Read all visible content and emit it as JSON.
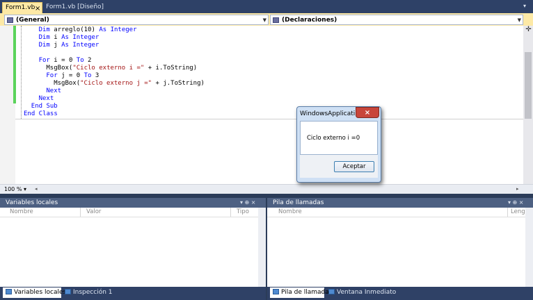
{
  "tabs": [
    {
      "label": "Form1.vb",
      "active": true
    },
    {
      "label": "Form1.vb [Diseño]",
      "active": false
    }
  ],
  "tab_close_glyph": "×",
  "combos": {
    "left": "(General)",
    "right": "(Declaraciones)"
  },
  "code_lines": [
    {
      "indent": "        ",
      "parts": [
        {
          "t": "Dim",
          "k": "kw"
        },
        {
          "t": " arreglo(10) "
        },
        {
          "t": "As",
          "k": "kw"
        },
        {
          "t": " "
        },
        {
          "t": "Integer",
          "k": "kw"
        }
      ]
    },
    {
      "indent": "        ",
      "parts": [
        {
          "t": "Dim",
          "k": "kw"
        },
        {
          "t": " i "
        },
        {
          "t": "As",
          "k": "kw"
        },
        {
          "t": " "
        },
        {
          "t": "Integer",
          "k": "kw"
        }
      ]
    },
    {
      "indent": "        ",
      "parts": [
        {
          "t": "Dim",
          "k": "kw"
        },
        {
          "t": " j "
        },
        {
          "t": "As",
          "k": "kw"
        },
        {
          "t": " "
        },
        {
          "t": "Integer",
          "k": "kw"
        }
      ]
    },
    {
      "indent": "",
      "parts": []
    },
    {
      "indent": "        ",
      "parts": [
        {
          "t": "For",
          "k": "kw"
        },
        {
          "t": " i = 0 "
        },
        {
          "t": "To",
          "k": "kw"
        },
        {
          "t": " 2"
        }
      ]
    },
    {
      "indent": "            ",
      "parts": [
        {
          "t": "MsgBox("
        },
        {
          "t": "\"Ciclo externo i =\"",
          "k": "str"
        },
        {
          "t": " + i.ToString)"
        }
      ]
    },
    {
      "indent": "            ",
      "parts": [
        {
          "t": "For",
          "k": "kw"
        },
        {
          "t": " j = 0 "
        },
        {
          "t": "To",
          "k": "kw"
        },
        {
          "t": " 3"
        }
      ]
    },
    {
      "indent": "                ",
      "parts": [
        {
          "t": "MsgBox("
        },
        {
          "t": "\"Ciclo externo j =\"",
          "k": "str"
        },
        {
          "t": " + j.ToString)"
        }
      ]
    },
    {
      "indent": "            ",
      "parts": [
        {
          "t": "Next",
          "k": "kw"
        }
      ]
    },
    {
      "indent": "        ",
      "parts": [
        {
          "t": "Next",
          "k": "kw"
        }
      ]
    },
    {
      "indent": "    ",
      "parts": [
        {
          "t": "End Sub",
          "k": "kw"
        }
      ]
    },
    {
      "indent": "",
      "parts": [
        {
          "t": "End Class",
          "k": "kw"
        }
      ]
    }
  ],
  "zoom": "100 %",
  "dialog": {
    "title": "WindowsApplicati...",
    "message": "Ciclo externo i =0",
    "ok_label": "Aceptar",
    "close_glyph": "×"
  },
  "locals": {
    "title": "Variables locales",
    "columns": [
      "Nombre",
      "Valor",
      "Tipo"
    ],
    "tabs": [
      {
        "label": "Variables locales",
        "active": true
      },
      {
        "label": "Inspección 1",
        "active": false
      }
    ]
  },
  "callstack": {
    "title": "Pila de llamadas",
    "columns": [
      "Nombre",
      "Leng"
    ],
    "tabs": [
      {
        "label": "Pila de llamadas",
        "active": true
      },
      {
        "label": "Ventana Inmediato",
        "active": false
      }
    ]
  },
  "tool_buttons": "▾ ⊕ ×",
  "colors": {
    "keyword": "#0000ff",
    "string": "#a31515",
    "change_bar": "#5bd35b",
    "active_tab": "#fde9a6"
  }
}
